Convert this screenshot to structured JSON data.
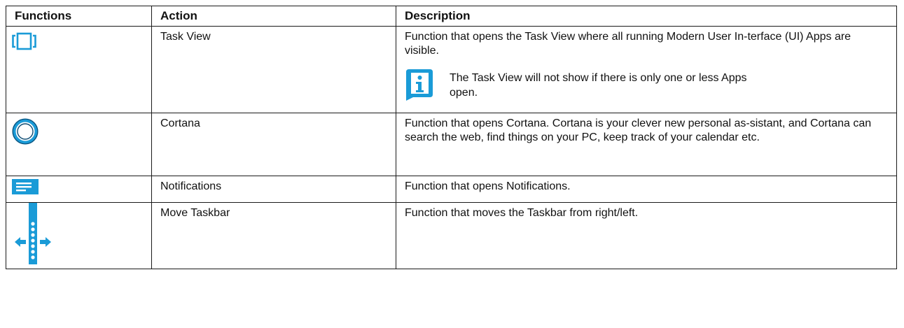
{
  "header": {
    "functions": "Functions",
    "action": "Action",
    "description": "Description"
  },
  "rows": [
    {
      "icon": "task-view-icon",
      "action": "Task View",
      "description": "Function that opens the Task View where all running Modern User In-terface (UI) Apps are visible.",
      "note": {
        "icon": "info-icon",
        "text": "The Task View will not show if there is only one or less Apps open."
      }
    },
    {
      "icon": "cortana-icon",
      "action": "Cortana",
      "description": "Function that opens Cortana. Cortana is your clever new personal as-sistant, and Cortana can search the web, find things on your PC, keep track of your calendar etc."
    },
    {
      "icon": "notifications-icon",
      "action": "Notifications",
      "description": "Function that opens Notifications."
    },
    {
      "icon": "move-taskbar-icon",
      "action": "Move Taskbar",
      "description": "Function that moves the Taskbar from right/left."
    }
  ],
  "colors": {
    "icon_blue": "#1a9bd7",
    "border": "#1a1a1a"
  }
}
